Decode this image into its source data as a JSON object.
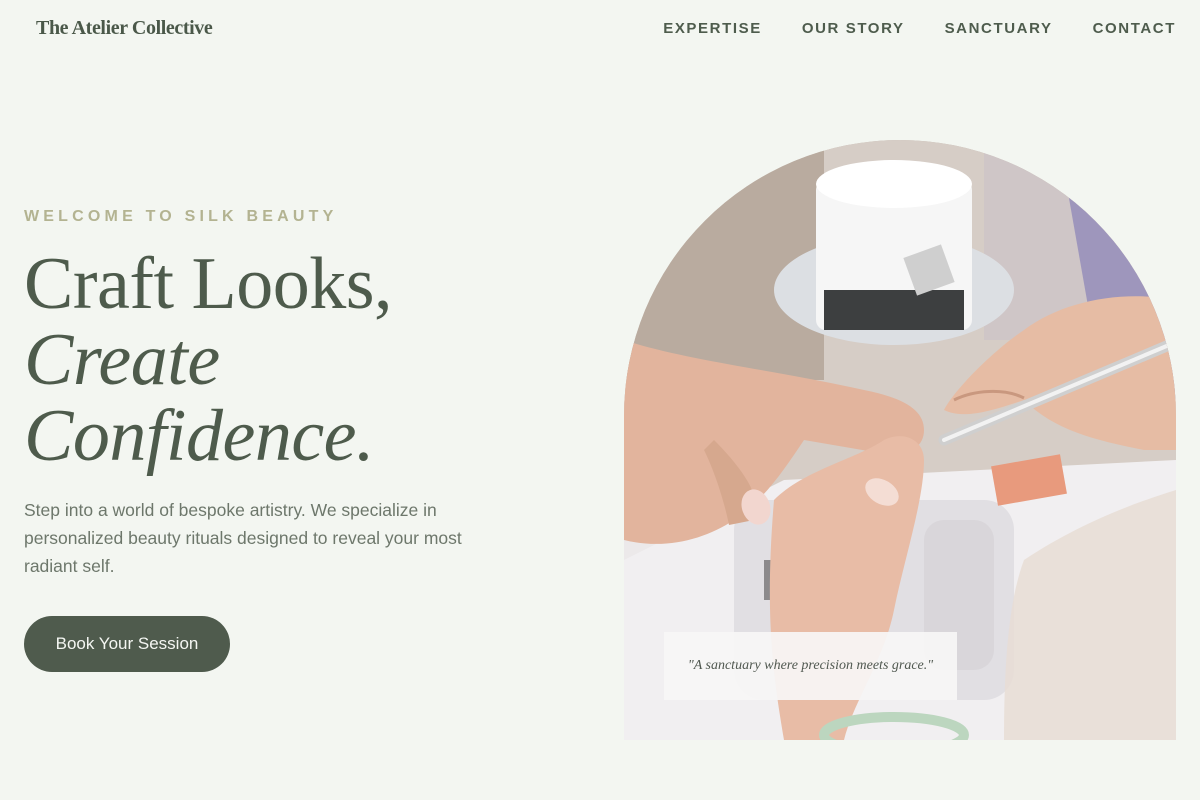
{
  "brand": {
    "name": "The Atelier Collective"
  },
  "nav": {
    "items": [
      {
        "label": "EXPERTISE"
      },
      {
        "label": "OUR STORY"
      },
      {
        "label": "SANCTUARY"
      },
      {
        "label": "CONTACT"
      }
    ]
  },
  "hero": {
    "eyebrow": "WELCOME TO SILK BEAUTY",
    "headline_line1": "Craft Looks,",
    "headline_line2": "Create",
    "headline_line3": "Confidence.",
    "description": "Step into a world of bespoke artistry. We specialize in personalized beauty rituals designed to reveal your most radiant self.",
    "cta_label": "Book Your Session",
    "quote": "\"A sanctuary where precision meets grace.\""
  },
  "colors": {
    "background": "#f3f6f1",
    "primary": "#4f5b4d",
    "eyebrow": "#b3b391",
    "body_text": "#6d776b"
  },
  "photo": {
    "subject": "manicure-in-progress"
  }
}
